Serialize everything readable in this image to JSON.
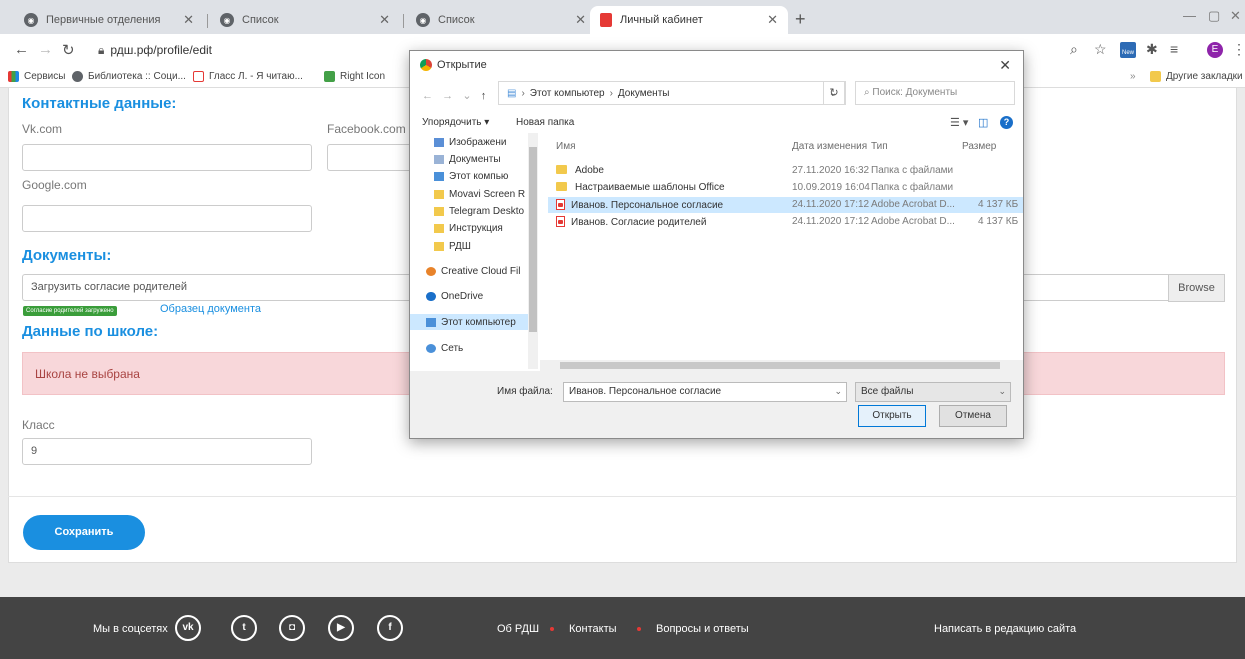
{
  "browser": {
    "tabs": [
      {
        "label": "Первичные отделения",
        "active": false
      },
      {
        "label": "Список",
        "active": false
      },
      {
        "label": "Список",
        "active": false
      },
      {
        "label": "Личный кабинет",
        "active": true
      }
    ],
    "url": "рдш.рф/profile/edit",
    "bookmarks": [
      "Сервисы",
      "Библиотека :: Соци...",
      "Гласс Л. - Я читаю...",
      "Right Icon"
    ],
    "other_bookmarks": "Другие закладки",
    "profile_initial": "E"
  },
  "page": {
    "contacts_title": "Контактные данные:",
    "vk_label": "Vk.com",
    "facebook_label": "Facebook.com",
    "google_label": "Google.com",
    "documents_title": "Документы:",
    "upload_value": "Загрузить согласие родителей",
    "browse_label": "Browse",
    "consent_badge": "Согласие родителей загружено",
    "sample_link": "Образец документа",
    "school_title": "Данные по школе:",
    "school_alert": "Школа не выбрана",
    "class_label": "Класс",
    "class_value": "9",
    "save_label": "Сохранить"
  },
  "footer": {
    "social_label": "Мы в соцсетях",
    "social_icons": [
      "vk-icon",
      "twitter-icon",
      "instagram-icon",
      "youtube-icon",
      "facebook-icon"
    ],
    "links": [
      "Об РДШ",
      "Контакты",
      "Вопросы и ответы"
    ],
    "write_link": "Написать в редакцию сайта"
  },
  "dialog": {
    "title": "Открытие",
    "path": [
      "Этот компьютер",
      "Документы"
    ],
    "search_placeholder": "Поиск: Документы",
    "organize": "Упорядочить",
    "new_folder": "Новая папка",
    "nav_items": [
      {
        "label": "Изображени",
        "icon": "pictures-icon"
      },
      {
        "label": "Документы",
        "icon": "documents-icon"
      },
      {
        "label": "Этот компью",
        "icon": "pc-icon"
      },
      {
        "label": "Movavi Screen R",
        "icon": "folder-icon"
      },
      {
        "label": "Telegram Deskto",
        "icon": "folder-icon"
      },
      {
        "label": "Инструкция",
        "icon": "folder-icon"
      },
      {
        "label": "РДШ",
        "icon": "folder-icon"
      },
      {
        "label": "Creative Cloud Fil",
        "icon": "creative-cloud-icon"
      },
      {
        "label": "OneDrive",
        "icon": "onedrive-icon"
      },
      {
        "label": "Этот компьютер",
        "icon": "pc-icon"
      },
      {
        "label": "Сеть",
        "icon": "network-icon"
      }
    ],
    "columns": {
      "name": "Имя",
      "date": "Дата изменения",
      "type": "Тип",
      "size": "Размер"
    },
    "files": [
      {
        "name": "Adobe",
        "date": "27.11.2020 16:32",
        "type": "Папка с файлами",
        "size": "",
        "kind": "folder"
      },
      {
        "name": "Настраиваемые шаблоны Office",
        "date": "10.09.2019 16:04",
        "type": "Папка с файлами",
        "size": "",
        "kind": "folder"
      },
      {
        "name": "Иванов. Персональное согласие",
        "date": "24.11.2020 17:12",
        "type": "Adobe Acrobat D...",
        "size": "4 137 КБ",
        "kind": "pdf"
      },
      {
        "name": "Иванов. Согласие родителей",
        "date": "24.11.2020 17:12",
        "type": "Adobe Acrobat D...",
        "size": "4 137 КБ",
        "kind": "pdf"
      }
    ],
    "filename_label": "Имя файла:",
    "filename_value": "Иванов. Персональное согласие",
    "filetype": "Все файлы",
    "open_label": "Открыть",
    "cancel_label": "Отмена"
  }
}
